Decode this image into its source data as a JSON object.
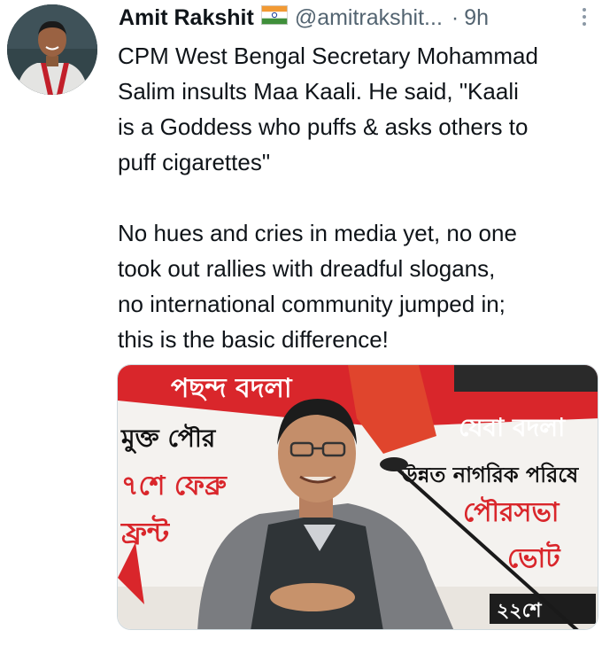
{
  "tweet": {
    "author_name": "Amit Rakshit",
    "author_flag_icon": "india-flag-icon",
    "author_handle": "@amitrakshit...",
    "separator": "·",
    "timestamp": "9h",
    "text": "CPM West Bengal Secretary Mohammad\nSalim insults Maa Kaali. He said, \"Kaali\nis a Goddess who puffs & asks others to\npuff cigarettes\"\n\nNo hues and cries in media yet, no one\ntook out rallies with dreadful slogans,\nno international community jumped in;\nthis is the basic difference!",
    "more_icon": "more-vertical-icon"
  },
  "media": {
    "banner_texts": [
      "পছন্দ বদলা",
      "যেবা বদলা",
      "মুক্ত পৌর",
      "উন্নত নাগরিক পরিষে",
      "৭শে ফেব্রু",
      "পৌরসভা",
      "ফ্রন্ট",
      "ভোট",
      "২২শে"
    ]
  },
  "colors": {
    "banner_red": "#d9262b",
    "handle_gray": "#536471"
  }
}
